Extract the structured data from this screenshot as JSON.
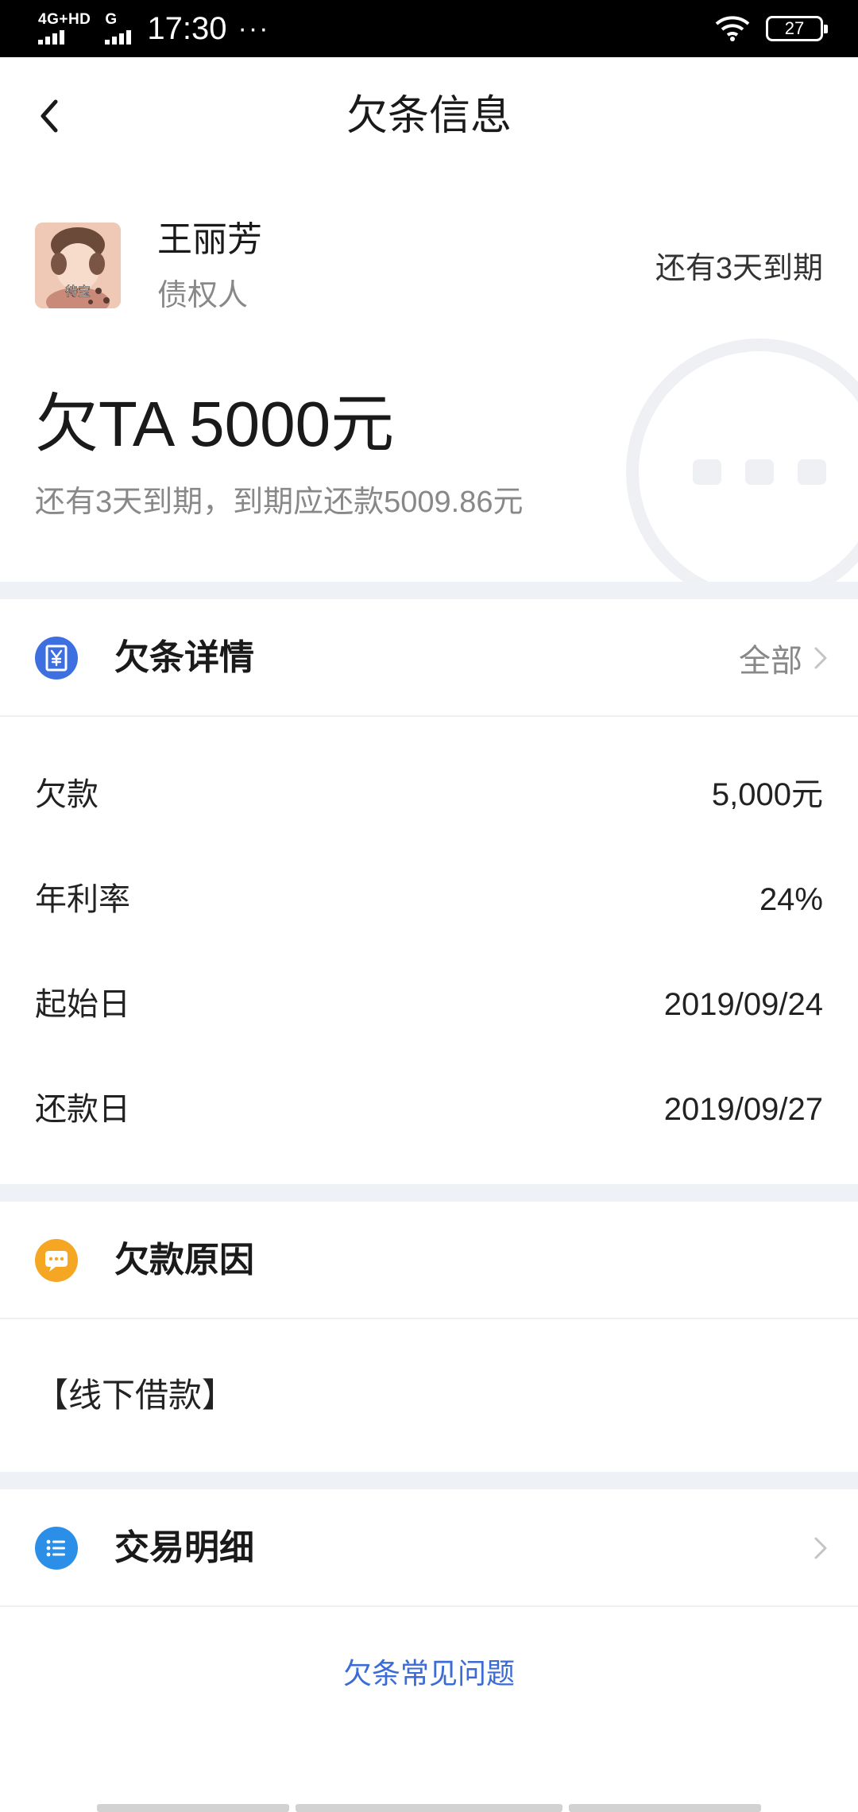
{
  "status_bar": {
    "network_label": "4G+HD",
    "network2_label": "G",
    "time": "17:30",
    "more": "···",
    "battery": "27"
  },
  "header": {
    "title": "欠条信息"
  },
  "creditor": {
    "name": "王丽芳",
    "role": "债权人",
    "due_text": "还有3天到期",
    "avatar_caption": "待宝"
  },
  "summary": {
    "amount": "欠TA 5000元",
    "subtitle": "还有3天到期，到期应还款5009.86元"
  },
  "details_section": {
    "title": "欠条详情",
    "action": "全部",
    "icon_color": "#3d6fe0",
    "rows": [
      {
        "label": "欠款",
        "value": "5,000元"
      },
      {
        "label": "年利率",
        "value": "24%"
      },
      {
        "label": "起始日",
        "value": "2019/09/24"
      },
      {
        "label": "还款日",
        "value": "2019/09/27"
      }
    ]
  },
  "reason_section": {
    "title": "欠款原因",
    "text": "【线下借款】",
    "icon_color": "#f5a623"
  },
  "transactions_section": {
    "title": "交易明细",
    "icon_color": "#2b8fe8"
  },
  "faq": {
    "link": "欠条常见问题"
  }
}
